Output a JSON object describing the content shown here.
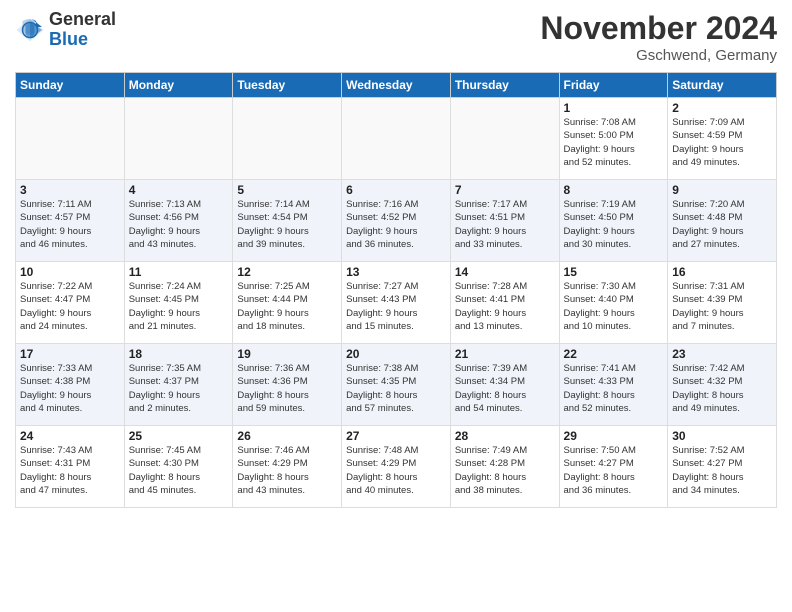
{
  "header": {
    "logo_general": "General",
    "logo_blue": "Blue",
    "title": "November 2024",
    "location": "Gschwend, Germany"
  },
  "weekdays": [
    "Sunday",
    "Monday",
    "Tuesday",
    "Wednesday",
    "Thursday",
    "Friday",
    "Saturday"
  ],
  "weeks": [
    [
      {
        "day": "",
        "info": ""
      },
      {
        "day": "",
        "info": ""
      },
      {
        "day": "",
        "info": ""
      },
      {
        "day": "",
        "info": ""
      },
      {
        "day": "",
        "info": ""
      },
      {
        "day": "1",
        "info": "Sunrise: 7:08 AM\nSunset: 5:00 PM\nDaylight: 9 hours\nand 52 minutes."
      },
      {
        "day": "2",
        "info": "Sunrise: 7:09 AM\nSunset: 4:59 PM\nDaylight: 9 hours\nand 49 minutes."
      }
    ],
    [
      {
        "day": "3",
        "info": "Sunrise: 7:11 AM\nSunset: 4:57 PM\nDaylight: 9 hours\nand 46 minutes."
      },
      {
        "day": "4",
        "info": "Sunrise: 7:13 AM\nSunset: 4:56 PM\nDaylight: 9 hours\nand 43 minutes."
      },
      {
        "day": "5",
        "info": "Sunrise: 7:14 AM\nSunset: 4:54 PM\nDaylight: 9 hours\nand 39 minutes."
      },
      {
        "day": "6",
        "info": "Sunrise: 7:16 AM\nSunset: 4:52 PM\nDaylight: 9 hours\nand 36 minutes."
      },
      {
        "day": "7",
        "info": "Sunrise: 7:17 AM\nSunset: 4:51 PM\nDaylight: 9 hours\nand 33 minutes."
      },
      {
        "day": "8",
        "info": "Sunrise: 7:19 AM\nSunset: 4:50 PM\nDaylight: 9 hours\nand 30 minutes."
      },
      {
        "day": "9",
        "info": "Sunrise: 7:20 AM\nSunset: 4:48 PM\nDaylight: 9 hours\nand 27 minutes."
      }
    ],
    [
      {
        "day": "10",
        "info": "Sunrise: 7:22 AM\nSunset: 4:47 PM\nDaylight: 9 hours\nand 24 minutes."
      },
      {
        "day": "11",
        "info": "Sunrise: 7:24 AM\nSunset: 4:45 PM\nDaylight: 9 hours\nand 21 minutes."
      },
      {
        "day": "12",
        "info": "Sunrise: 7:25 AM\nSunset: 4:44 PM\nDaylight: 9 hours\nand 18 minutes."
      },
      {
        "day": "13",
        "info": "Sunrise: 7:27 AM\nSunset: 4:43 PM\nDaylight: 9 hours\nand 15 minutes."
      },
      {
        "day": "14",
        "info": "Sunrise: 7:28 AM\nSunset: 4:41 PM\nDaylight: 9 hours\nand 13 minutes."
      },
      {
        "day": "15",
        "info": "Sunrise: 7:30 AM\nSunset: 4:40 PM\nDaylight: 9 hours\nand 10 minutes."
      },
      {
        "day": "16",
        "info": "Sunrise: 7:31 AM\nSunset: 4:39 PM\nDaylight: 9 hours\nand 7 minutes."
      }
    ],
    [
      {
        "day": "17",
        "info": "Sunrise: 7:33 AM\nSunset: 4:38 PM\nDaylight: 9 hours\nand 4 minutes."
      },
      {
        "day": "18",
        "info": "Sunrise: 7:35 AM\nSunset: 4:37 PM\nDaylight: 9 hours\nand 2 minutes."
      },
      {
        "day": "19",
        "info": "Sunrise: 7:36 AM\nSunset: 4:36 PM\nDaylight: 8 hours\nand 59 minutes."
      },
      {
        "day": "20",
        "info": "Sunrise: 7:38 AM\nSunset: 4:35 PM\nDaylight: 8 hours\nand 57 minutes."
      },
      {
        "day": "21",
        "info": "Sunrise: 7:39 AM\nSunset: 4:34 PM\nDaylight: 8 hours\nand 54 minutes."
      },
      {
        "day": "22",
        "info": "Sunrise: 7:41 AM\nSunset: 4:33 PM\nDaylight: 8 hours\nand 52 minutes."
      },
      {
        "day": "23",
        "info": "Sunrise: 7:42 AM\nSunset: 4:32 PM\nDaylight: 8 hours\nand 49 minutes."
      }
    ],
    [
      {
        "day": "24",
        "info": "Sunrise: 7:43 AM\nSunset: 4:31 PM\nDaylight: 8 hours\nand 47 minutes."
      },
      {
        "day": "25",
        "info": "Sunrise: 7:45 AM\nSunset: 4:30 PM\nDaylight: 8 hours\nand 45 minutes."
      },
      {
        "day": "26",
        "info": "Sunrise: 7:46 AM\nSunset: 4:29 PM\nDaylight: 8 hours\nand 43 minutes."
      },
      {
        "day": "27",
        "info": "Sunrise: 7:48 AM\nSunset: 4:29 PM\nDaylight: 8 hours\nand 40 minutes."
      },
      {
        "day": "28",
        "info": "Sunrise: 7:49 AM\nSunset: 4:28 PM\nDaylight: 8 hours\nand 38 minutes."
      },
      {
        "day": "29",
        "info": "Sunrise: 7:50 AM\nSunset: 4:27 PM\nDaylight: 8 hours\nand 36 minutes."
      },
      {
        "day": "30",
        "info": "Sunrise: 7:52 AM\nSunset: 4:27 PM\nDaylight: 8 hours\nand 34 minutes."
      }
    ]
  ]
}
